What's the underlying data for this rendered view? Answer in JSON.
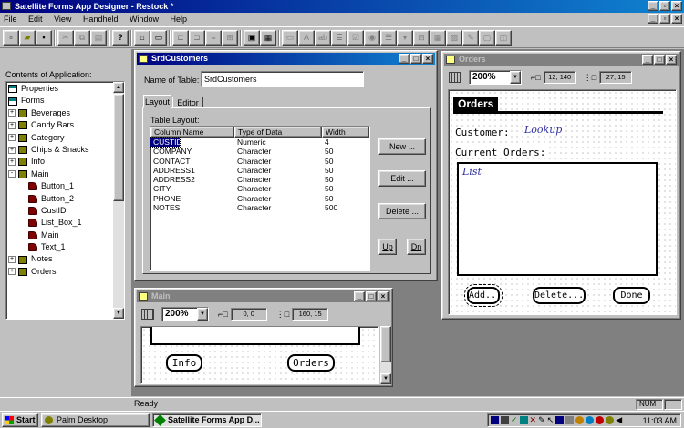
{
  "app": {
    "title": "Satellite Forms App Designer - Restock *"
  },
  "menu": [
    "File",
    "Edit",
    "View",
    "Handheld",
    "Window",
    "Help"
  ],
  "toolbar": {
    "icons": [
      "new-icon",
      "open-icon",
      "save-icon",
      "cut-icon",
      "copy-icon",
      "paste-icon",
      "help-icon",
      "home-icon",
      "form-icon",
      "align-left-icon",
      "align-center-icon",
      "align-right-icon",
      "distribute-icon",
      "group-icon",
      "ungroup-icon"
    ],
    "palette_icons": [
      "select-icon",
      "text-tool-icon",
      "edit-tool-icon",
      "paragraph-tool-icon",
      "check-tool-icon",
      "radio-tool-icon",
      "list-tool-icon",
      "lookup-tool-icon",
      "combo-tool-icon",
      "table-tool-icon",
      "image-tool-icon",
      "ink-tool-icon",
      "button-tool-icon",
      "graffiti-tool-icon"
    ]
  },
  "tree": {
    "label": "Contents of Application:",
    "items": [
      {
        "label": "Properties",
        "level": 0,
        "expander": "",
        "icon": "properties-icon"
      },
      {
        "label": "Forms",
        "level": 0,
        "expander": "",
        "icon": "forms-folder-icon"
      },
      {
        "label": "Beverages",
        "level": 1,
        "expander": "+",
        "icon": "table-icon"
      },
      {
        "label": "Candy Bars",
        "level": 1,
        "expander": "+",
        "icon": "table-icon"
      },
      {
        "label": "Category",
        "level": 1,
        "expander": "+",
        "icon": "table-icon"
      },
      {
        "label": "Chips & Snacks",
        "level": 1,
        "expander": "+",
        "icon": "table-icon"
      },
      {
        "label": "Info",
        "level": 1,
        "expander": "+",
        "icon": "table-icon"
      },
      {
        "label": "Main",
        "level": 1,
        "expander": "-",
        "icon": "table-icon"
      },
      {
        "label": "Button_1",
        "level": 2,
        "expander": "",
        "icon": "control-icon"
      },
      {
        "label": "Button_2",
        "level": 2,
        "expander": "",
        "icon": "control-icon"
      },
      {
        "label": "CustID",
        "level": 2,
        "expander": "",
        "icon": "control-icon"
      },
      {
        "label": "List_Box_1",
        "level": 2,
        "expander": "",
        "icon": "control-icon"
      },
      {
        "label": "Main",
        "level": 2,
        "expander": "",
        "icon": "control-icon"
      },
      {
        "label": "Text_1",
        "level": 2,
        "expander": "",
        "icon": "control-icon"
      },
      {
        "label": "Notes",
        "level": 1,
        "expander": "+",
        "icon": "table-icon"
      },
      {
        "label": "Orders",
        "level": 1,
        "expander": "+",
        "icon": "table-icon"
      }
    ]
  },
  "srd": {
    "title": "SrdCustomers",
    "name_label": "Name of Table:",
    "name_value": "SrdCustomers",
    "tabs": [
      "Layout",
      "Editor"
    ],
    "layout_label": "Table Layout:",
    "columns": [
      "Column Name",
      "Type of Data",
      "Width"
    ],
    "rows": [
      [
        "CUSTID",
        "Numeric",
        "4"
      ],
      [
        "COMPANY",
        "Character",
        "50"
      ],
      [
        "CONTACT",
        "Character",
        "50"
      ],
      [
        "ADDRESS1",
        "Character",
        "50"
      ],
      [
        "ADDRESS2",
        "Character",
        "50"
      ],
      [
        "CITY",
        "Character",
        "50"
      ],
      [
        "PHONE",
        "Character",
        "50"
      ],
      [
        "NOTES",
        "Character",
        "500"
      ]
    ],
    "buttons": {
      "new": "New ...",
      "edit": "Edit ...",
      "delete": "Delete ...",
      "up": "Up",
      "dn": "Dn"
    }
  },
  "orders": {
    "title": "Orders",
    "zoom": "200%",
    "pos": "12, 140",
    "size": "27, 15",
    "form_title": "Orders",
    "customer_label": "Customer:",
    "customer_value": "Lookup",
    "current_orders_label": "Current Orders:",
    "list_label": "List",
    "buttons": {
      "add": "Add...",
      "delete": "Delete...",
      "done": "Done"
    }
  },
  "main": {
    "title": "Main",
    "zoom": "200%",
    "pos": "0, 0",
    "size": "160, 15",
    "buttons": {
      "info": "Info",
      "orders": "Orders"
    }
  },
  "status": {
    "text": "Ready",
    "num": "NUM"
  },
  "taskbar": {
    "start": "Start",
    "tasks": [
      "Palm Desktop",
      "Satellite Forms App D..."
    ],
    "time": "11:03 AM"
  }
}
